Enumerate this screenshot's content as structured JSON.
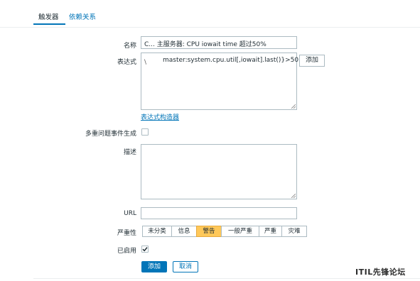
{
  "tabs": [
    {
      "label": "触发器",
      "active": true
    },
    {
      "label": "依赖关系",
      "active": false
    }
  ],
  "form": {
    "name_label": "名称",
    "name_value": "C... 主服务器: CPU iowait time 超过50%",
    "expression_label": "表达式",
    "expression_value": "master:system.cpu.util[,iowait].last()}>50",
    "expression_prefix": "\\",
    "add_button": "添加",
    "expression_builder_link": "表达式构造器",
    "multiple_events_label": "多重问题事件生成",
    "multiple_events_checked": false,
    "description_label": "描述",
    "description_value": "",
    "url_label": "URL",
    "url_value": "",
    "severity_label": "严重性",
    "severity_options": [
      "未分类",
      "信息",
      "警告",
      "一般严重",
      "严重",
      "灾难"
    ],
    "severity_selected": "警告",
    "enabled_label": "已启用",
    "enabled_checked": true,
    "submit_button": "添加",
    "cancel_button": "取消"
  },
  "watermark": "ITIL先锋论坛",
  "colors": {
    "accent": "#0275b8",
    "severity_warning": "#ffc859",
    "border": "#acbbc2"
  }
}
